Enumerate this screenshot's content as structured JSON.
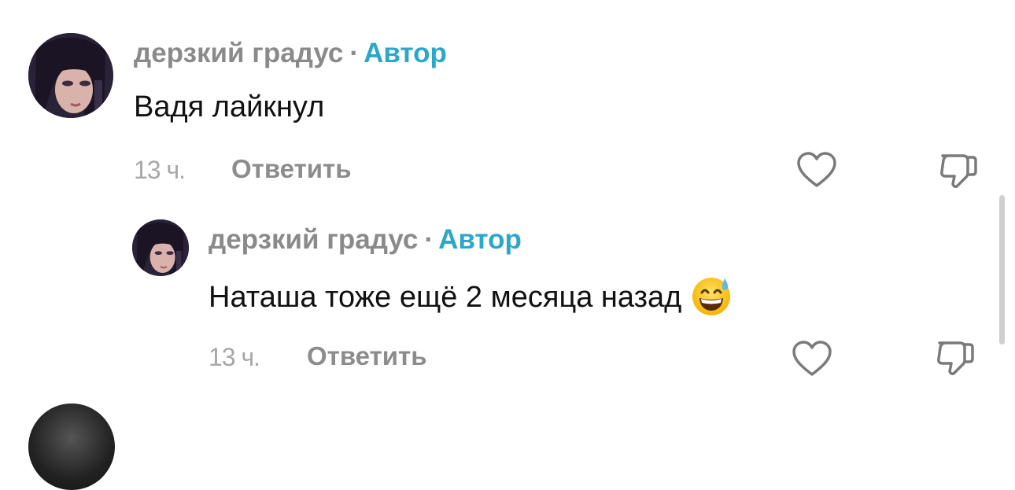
{
  "comments": [
    {
      "author": "дерзкий градус",
      "separator": "·",
      "badge": "Автор",
      "text": "Вадя лайкнул",
      "time": "13 ч.",
      "reply_label": "Ответить"
    },
    {
      "author": "дерзкий градус",
      "separator": "·",
      "badge": "Автор",
      "text": "Наташа тоже ещё 2 месяца назад",
      "emoji": "grinning-face-with-sweat",
      "time": "13 ч.",
      "reply_label": "Ответить"
    }
  ],
  "icons": {
    "like": "heart-outline-icon",
    "dislike": "thumbs-down-outline-icon"
  },
  "colors": {
    "badge": "#2aa7c9",
    "author": "#8a8a8a",
    "muted": "#a7a7a7"
  }
}
